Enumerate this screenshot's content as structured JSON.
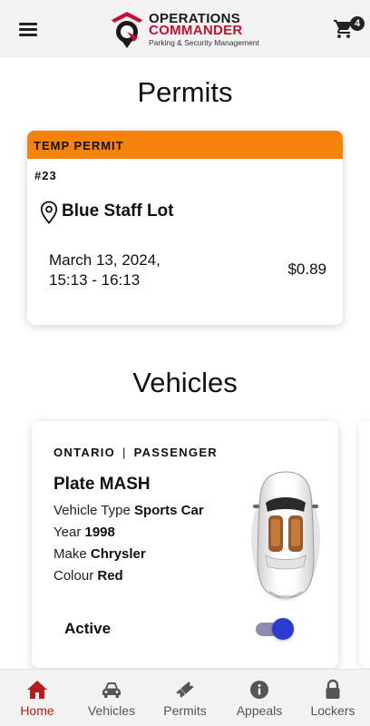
{
  "header": {
    "menu_icon": "hamburger-menu-icon",
    "logo": {
      "line1": "OPERATIONS",
      "line2": "COMMANDER",
      "tagline": "Parking & Security Management"
    },
    "cart_icon": "shopping-cart-icon",
    "cart_count": "4"
  },
  "permits": {
    "title": "Permits",
    "card": {
      "type": "TEMP PERMIT",
      "number": "#23",
      "location_icon": "map-pin-icon",
      "location": "Blue Staff Lot",
      "date": "March 13, 2024,",
      "time": "15:13 - 16:13",
      "price": "$0.89"
    }
  },
  "vehicles": {
    "title": "Vehicles",
    "card": {
      "province": "ONTARIO",
      "separator": "|",
      "category": "PASSENGER",
      "plate_prefix": "Plate",
      "plate": "MASH",
      "type_label": "Vehicle Type",
      "type_value": "Sports Car",
      "year_label": "Year",
      "year_value": "1998",
      "make_label": "Make",
      "make_value": "Chrysler",
      "colour_label": "Colour",
      "colour_value": "Red",
      "active_label": "Active",
      "active": true
    }
  },
  "bottom_nav": {
    "items": [
      {
        "label": "Home",
        "icon": "home-icon",
        "active": true
      },
      {
        "label": "Vehicles",
        "icon": "car-icon",
        "active": false
      },
      {
        "label": "Permits",
        "icon": "ticket-icon",
        "active": false
      },
      {
        "label": "Appeals",
        "icon": "info-icon",
        "active": false
      },
      {
        "label": "Lockers",
        "icon": "lock-icon",
        "active": false
      }
    ]
  },
  "colors": {
    "accent_orange": "#f5820b",
    "brand_red": "#c8102e",
    "active_nav": "#b91c1c",
    "toggle_blue": "#2c3ad1"
  }
}
